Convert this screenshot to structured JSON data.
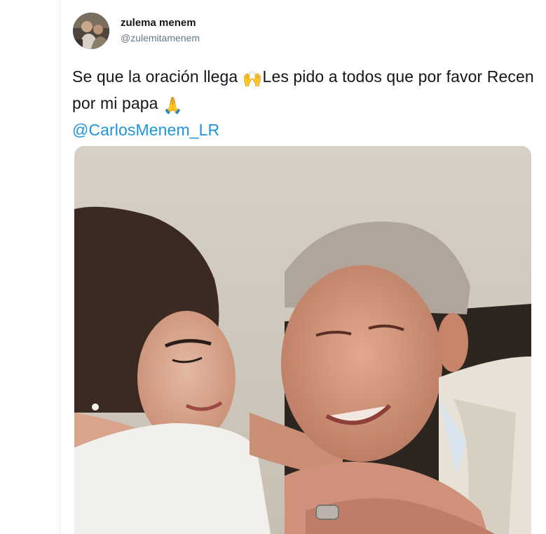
{
  "tweet": {
    "author_name": "zulema menem",
    "author_handle": "@zulemitamenem",
    "text_part1": "Se que la oración llega ",
    "emoji_raised_hands": "🙌",
    "text_part2": "Les pido a todos que por favor Recen por mi papa ",
    "emoji_praying": "🙏",
    "mention": "@CarlosMenem_LR"
  },
  "colors": {
    "text": "#14171a",
    "secondary": "#657786",
    "link": "#1b95e0",
    "border": "#e6ecf0"
  },
  "icons": {
    "avatar": "profile-photo",
    "raised_hands": "raised-hands-emoji",
    "praying": "praying-hands-emoji"
  }
}
